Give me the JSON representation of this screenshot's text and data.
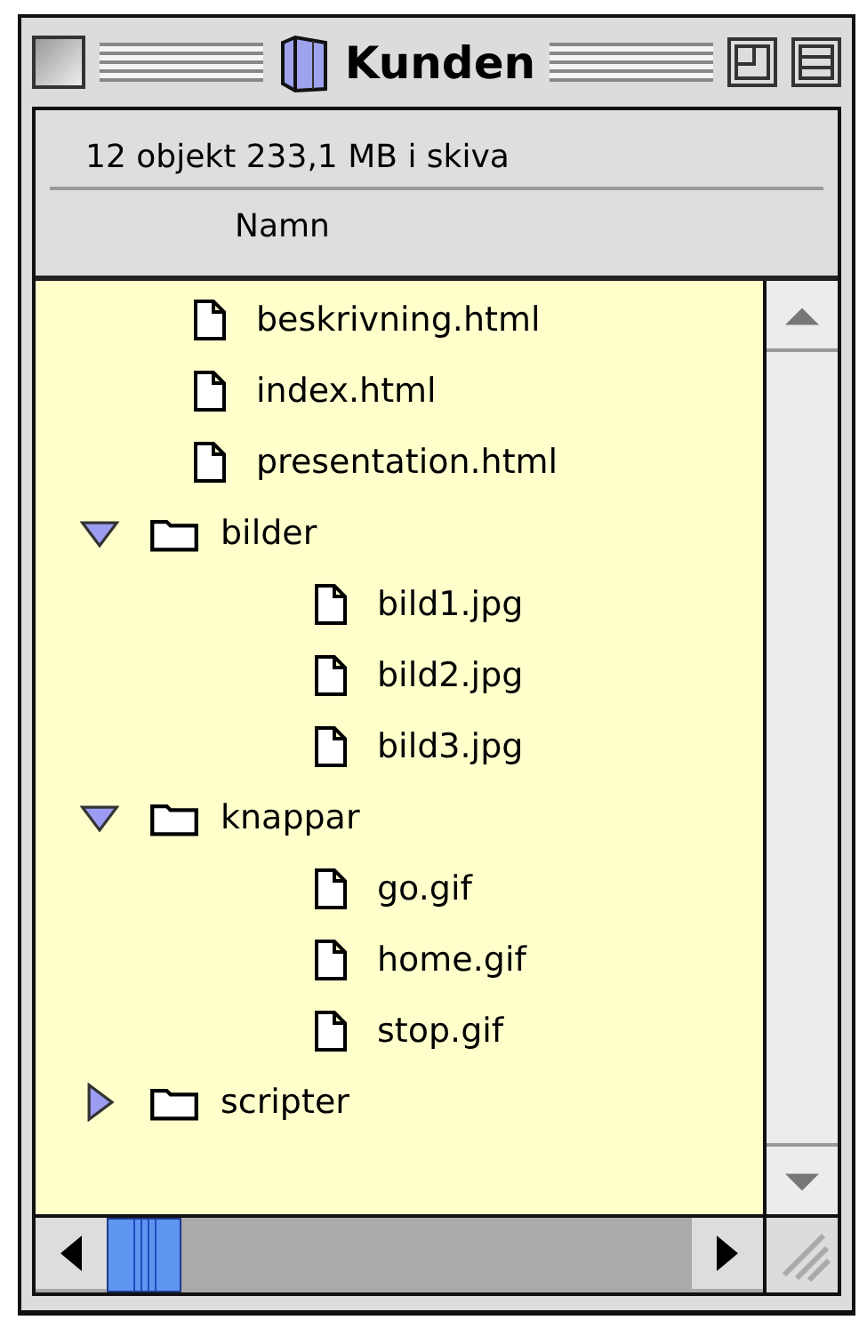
{
  "window": {
    "title": "Kunden"
  },
  "info": {
    "text": "12 objekt  233,1 MB i skiva"
  },
  "columns": [
    "Namn"
  ],
  "items": [
    {
      "kind": "file",
      "name": "beskrivning.html"
    },
    {
      "kind": "file",
      "name": "index.html"
    },
    {
      "kind": "file",
      "name": "presentation.html"
    },
    {
      "kind": "folder",
      "name": "bilder",
      "expanded": true,
      "children": [
        {
          "kind": "file",
          "name": "bild1.jpg"
        },
        {
          "kind": "file",
          "name": "bild2.jpg"
        },
        {
          "kind": "file",
          "name": "bild3.jpg"
        }
      ]
    },
    {
      "kind": "folder",
      "name": "knappar",
      "expanded": true,
      "children": [
        {
          "kind": "file",
          "name": "go.gif"
        },
        {
          "kind": "file",
          "name": "home.gif"
        },
        {
          "kind": "file",
          "name": "stop.gif"
        }
      ]
    },
    {
      "kind": "folder",
      "name": "scripter",
      "expanded": false
    }
  ]
}
